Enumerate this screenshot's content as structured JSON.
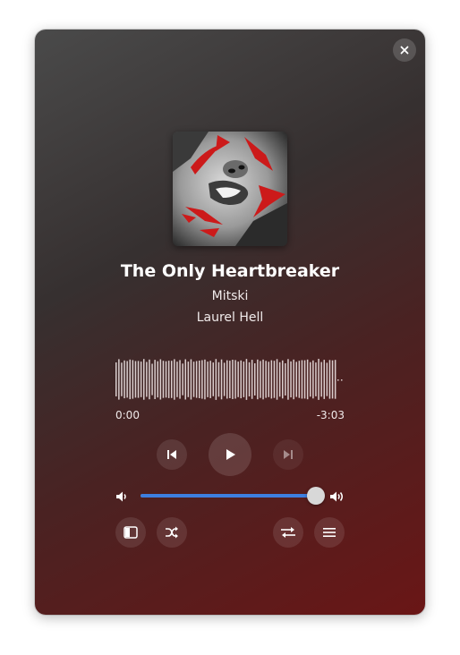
{
  "track": {
    "title": "The Only Heartbreaker",
    "artist": "Mitski",
    "album": "Laurel Hell"
  },
  "playback": {
    "elapsed": "0:00",
    "remaining": "-3:03",
    "progress": 0,
    "state": "paused"
  },
  "volume": {
    "level": 0.99,
    "accent_color": "#3d7fe0"
  },
  "icons": {
    "close": "close-icon",
    "previous": "skip-previous-icon",
    "play": "play-icon",
    "next": "skip-next-icon",
    "volume_low": "volume-low-icon",
    "volume_high": "volume-high-icon",
    "sidebar": "sidebar-toggle-icon",
    "shuffle": "shuffle-icon",
    "repeat": "repeat-icon",
    "queue": "queue-list-icon"
  },
  "colors": {
    "gradient_top": "#4a4a4a",
    "gradient_bottom": "#6a1616",
    "cover_accent": "#cc1a1a"
  }
}
